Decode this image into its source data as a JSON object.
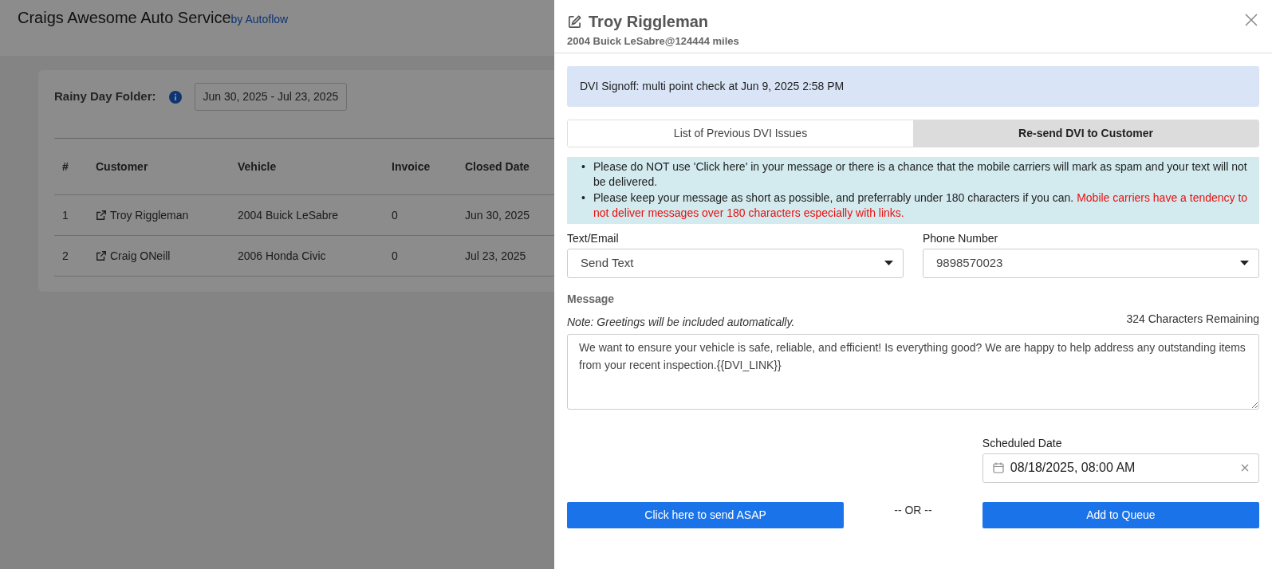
{
  "app": {
    "title": "Craigs Awesome Auto Service",
    "subtitle": "by Autoflow"
  },
  "folder": {
    "label": "Rainy Day Folder:",
    "date_range": "Jun 30, 2025 - Jul 23, 2025"
  },
  "table": {
    "columns": [
      "#",
      "Customer",
      "Vehicle",
      "Invoice",
      "Closed Date"
    ],
    "rows": [
      {
        "cells": [
          "1",
          "Troy Riggleman",
          "2004 Buick LeSabre",
          "0",
          "Jun 30, 2025"
        ]
      },
      {
        "cells": [
          "2",
          "Craig ONeill",
          "2006 Honda Civic",
          "0",
          "Jul 23, 2025"
        ]
      }
    ]
  },
  "panel": {
    "title": "Troy Riggleman",
    "subtitle": "2004 Buick LeSabre@124444 miles",
    "signoff": "DVI Signoff: multi point check at Jun 9, 2025 2:58 PM",
    "tabs": [
      {
        "label": "List of Previous DVI Issues",
        "selected": false
      },
      {
        "label": "Re-send DVI to Customer",
        "selected": true
      }
    ],
    "notes": [
      {
        "marker": "•",
        "text": "Please do NOT use 'Click here' in your message or there is a chance that the mobile carriers will mark as spam and your text will not be delivered."
      },
      {
        "marker": "•",
        "text": "Please keep your message as short as possible, and preferrably under 180 characters if you can.",
        "warning": "Mobile carriers have a tendency to not deliver messages over 180 characters especially with links."
      }
    ],
    "text_email": {
      "label": "Text/Email",
      "value": "Send Text"
    },
    "phone": {
      "label": "Phone Number",
      "value": "9898570023"
    },
    "message": {
      "label": "Message",
      "remaining": "324 Characters Remaining",
      "note": "Note: Greetings will be included automatically.",
      "value": "We want to ensure your vehicle is safe, reliable, and efficient! Is everything good? We are happy to help address any outstanding items from your recent inspection.{{DVI_LINK}}"
    },
    "scheduled": {
      "label": "Scheduled Date",
      "value": "08/18/2025, 08:00 AM"
    },
    "send_button": "Click here to send ASAP",
    "or_text": "-- OR --",
    "queue_button": "Add to Queue"
  }
}
